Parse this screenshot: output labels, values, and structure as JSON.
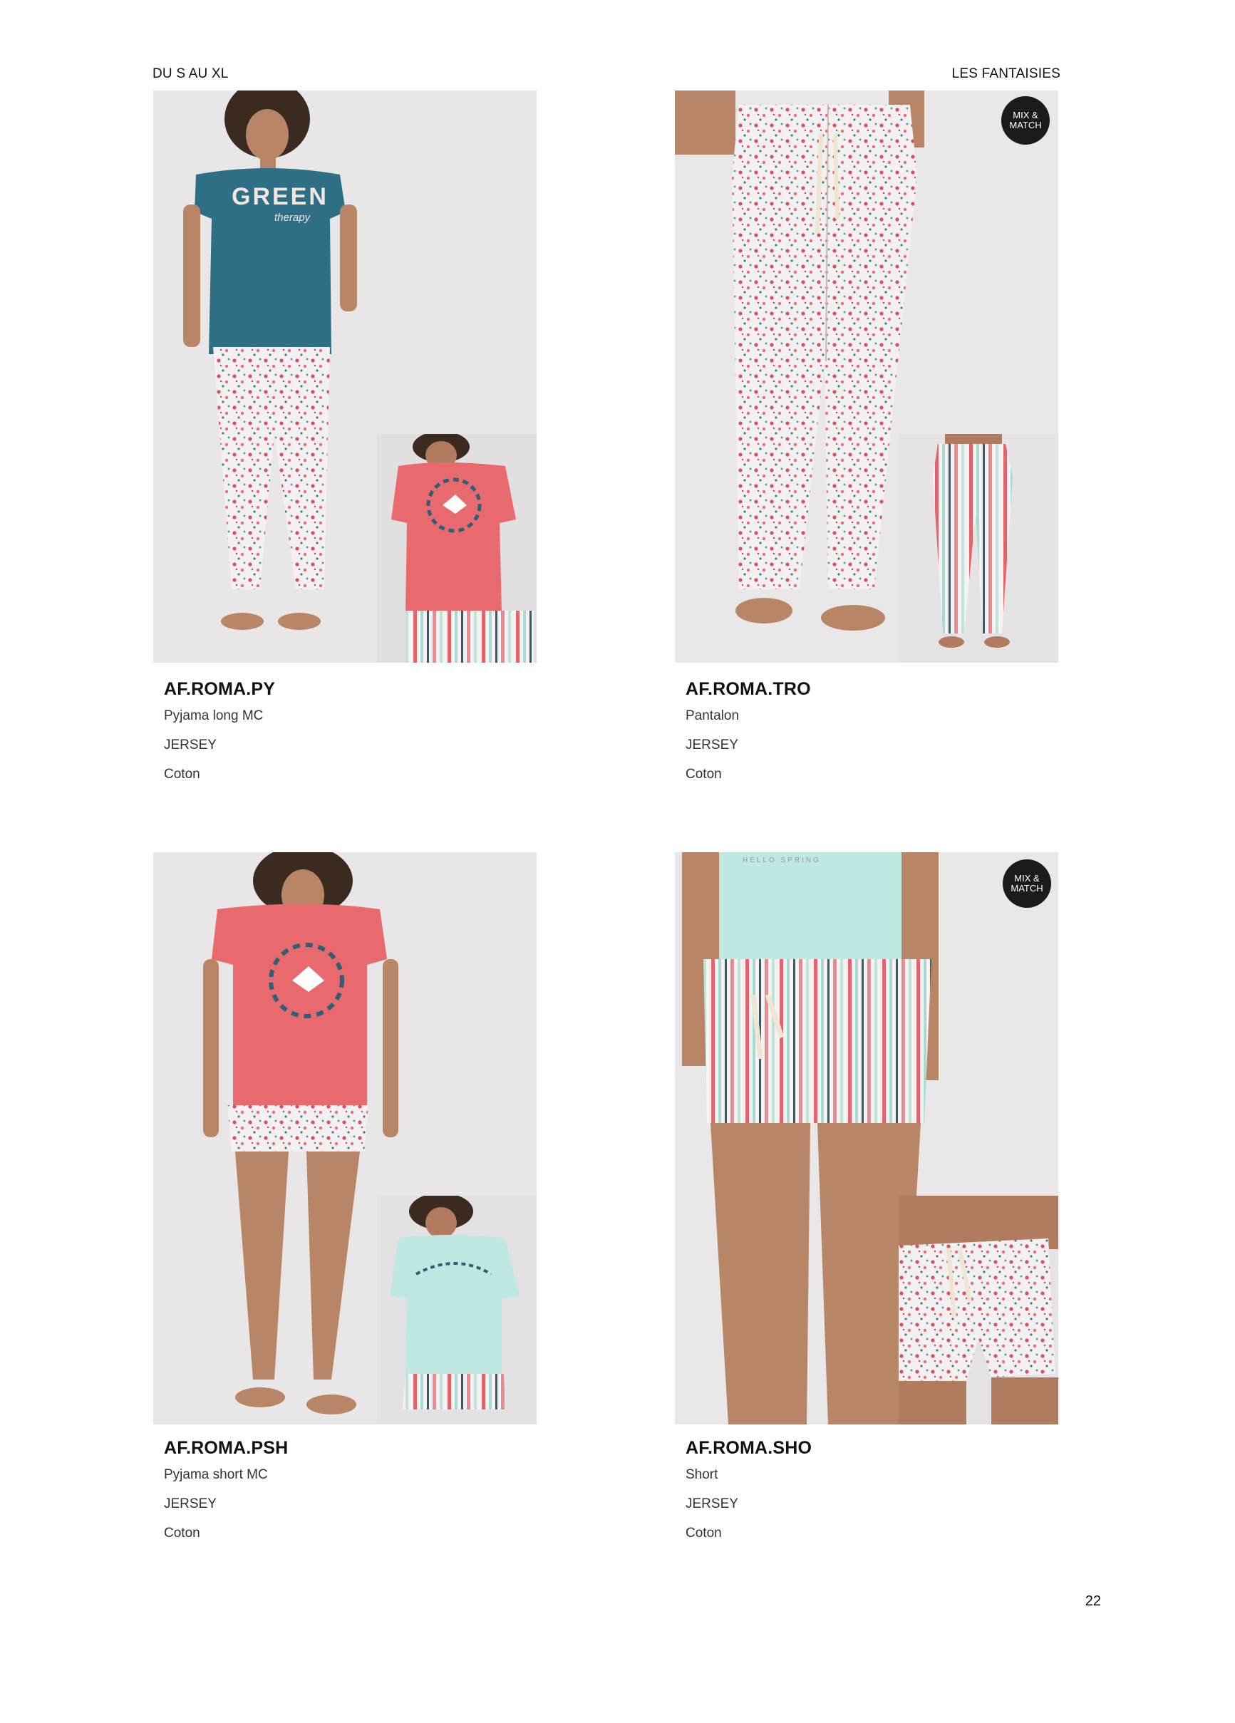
{
  "header": {
    "left": "DU S AU XL",
    "right": "LES FANTAISIES"
  },
  "badge": {
    "line1": "MIX &",
    "line2": "MATCH"
  },
  "products": [
    {
      "ref": "AF.ROMA.PY",
      "name": "Pyjama long MC",
      "fabric": "JERSEY",
      "material": "Coton",
      "shirt_print": "GREEN",
      "shirt_print_sub": "therapy"
    },
    {
      "ref": "AF.ROMA.TRO",
      "name": "Pantalon",
      "fabric": "JERSEY",
      "material": "Coton"
    },
    {
      "ref": "AF.ROMA.PSH",
      "name": "Pyjama short MC",
      "fabric": "JERSEY",
      "material": "Coton"
    },
    {
      "ref": "AF.ROMA.SHO",
      "name": "Short",
      "fabric": "JERSEY",
      "material": "Coton",
      "shirt_print": "HELLO SPRING"
    }
  ],
  "page_number": "22",
  "colors": {
    "teal_shirt": "#2f6f86",
    "coral_shirt": "#e86a6f",
    "mint_shirt": "#bfe8e3",
    "floral_base": "#f3eef0",
    "floral_dot": "#d84f5d",
    "floral_leaf": "#3a7d8c"
  }
}
